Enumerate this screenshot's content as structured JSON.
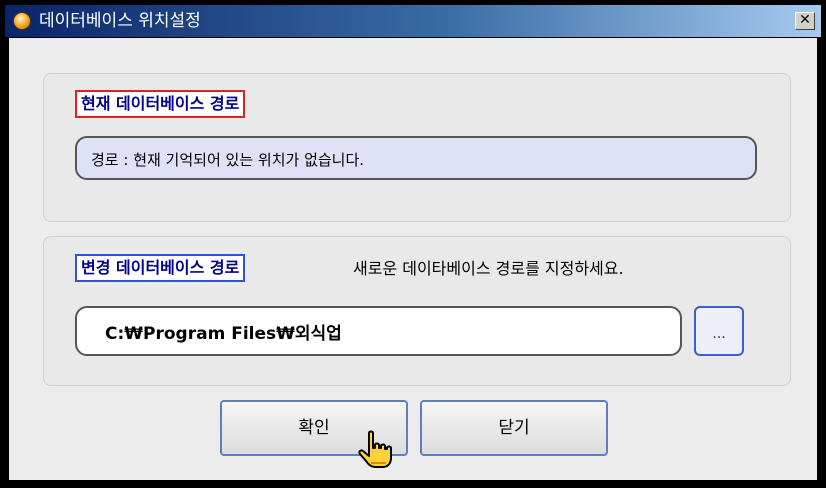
{
  "window": {
    "title": "데이터베이스 위치설정",
    "close_glyph": "✕"
  },
  "current": {
    "label": "현재 데이터베이스 경로",
    "value": "경로 : 현재 기억되어 있는 위치가 없습니다."
  },
  "change": {
    "label": "변경 데이터베이스 경로",
    "hint": "새로운 데이타베이스 경로를 지정하세요.",
    "path_value": "C:₩Program Files₩외식업",
    "browse_label": "..."
  },
  "buttons": {
    "ok_label": "확인",
    "close_label": "닫기"
  },
  "colors": {
    "title_bar": "#0a246a",
    "label_text": "#00008b",
    "current_label_border": "#e02020",
    "change_label_border": "#3050e0",
    "current_path_bg": "#dfe2f7",
    "button_border": "#5f7fc0"
  },
  "icons": {
    "app": "database-app-icon",
    "cursor": "hand-pointer-icon"
  }
}
